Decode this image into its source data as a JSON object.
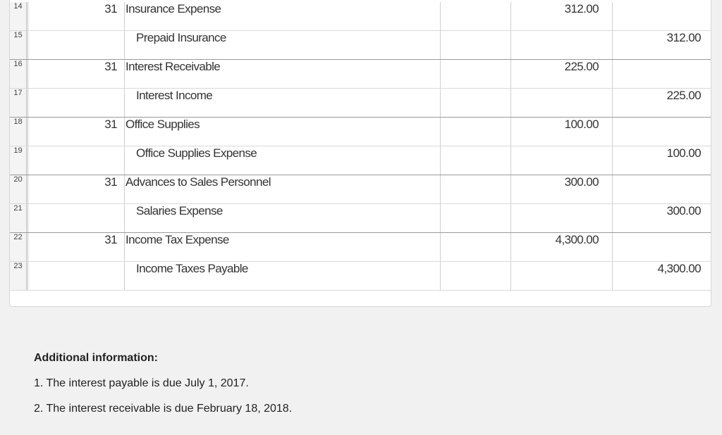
{
  "journal": {
    "rows": [
      {
        "num": "14",
        "day": "31",
        "account": "Insurance Expense",
        "debit": "312.00",
        "credit": ""
      },
      {
        "num": "15",
        "day": "",
        "account": "Prepaid Insurance",
        "debit": "",
        "credit": "312.00"
      },
      {
        "num": "16",
        "day": "31",
        "account": "Interest Receivable",
        "debit": "225.00",
        "credit": ""
      },
      {
        "num": "17",
        "day": "",
        "account": "Interest Income",
        "debit": "",
        "credit": "225.00"
      },
      {
        "num": "18",
        "day": "31",
        "account": "Office Supplies",
        "debit": "100.00",
        "credit": ""
      },
      {
        "num": "19",
        "day": "",
        "account": "Office Supplies Expense",
        "debit": "",
        "credit": "100.00"
      },
      {
        "num": "20",
        "day": "31",
        "account": "Advances to Sales Personnel",
        "debit": "300.00",
        "credit": ""
      },
      {
        "num": "21",
        "day": "",
        "account": "Salaries Expense",
        "debit": "",
        "credit": "300.00"
      },
      {
        "num": "22",
        "day": "31",
        "account": "Income Tax Expense",
        "debit": "4,300.00",
        "credit": ""
      },
      {
        "num": "23",
        "day": "",
        "account": "Income Taxes Payable",
        "debit": "",
        "credit": "4,300.00"
      }
    ]
  },
  "additional_info": {
    "title": "Additional information:",
    "items": [
      "1.  The interest payable is due July 1, 2017.",
      "2.  The interest receivable is due February 18, 2018."
    ]
  }
}
